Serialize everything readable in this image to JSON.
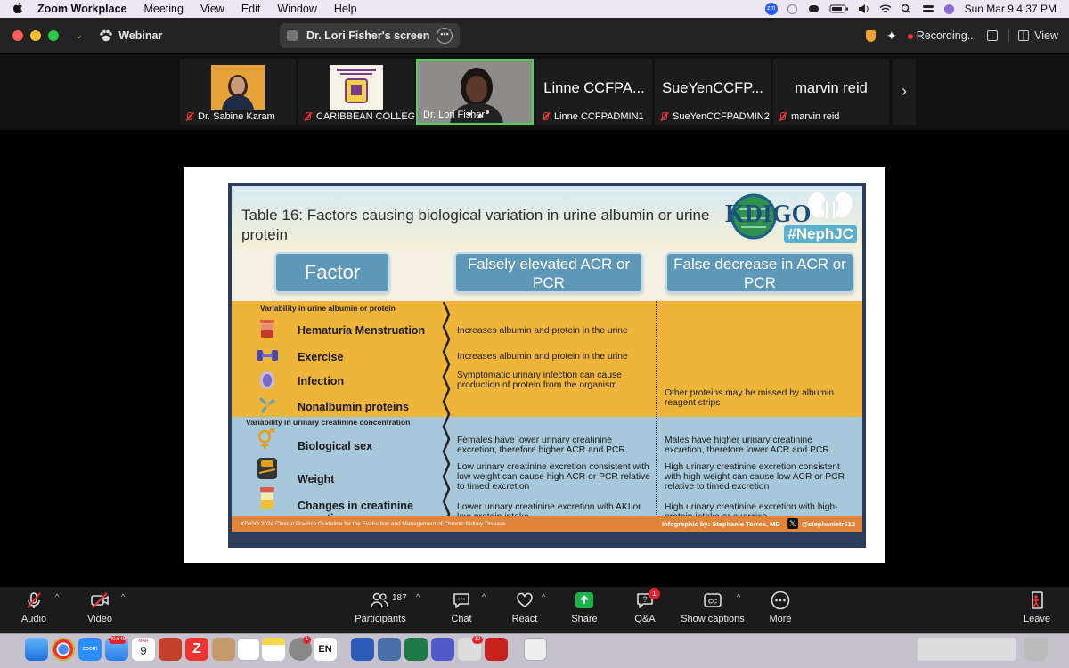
{
  "menubar": {
    "app": "Zoom Workplace",
    "items": [
      "Meeting",
      "View",
      "Edit",
      "Window",
      "Help"
    ],
    "datetime": "Sun Mar 9  4:37 PM"
  },
  "window": {
    "webinar_label": "Webinar",
    "share_title": "Dr. Lori Fisher's screen",
    "recording_label": "Recording...",
    "view_label": "View"
  },
  "participants_strip": [
    {
      "name": "Dr. Sabine Karam",
      "kind": "photo"
    },
    {
      "name": "CARIBBEAN COLLEG...",
      "kind": "logo"
    },
    {
      "name": "Dr. Lori Fisher",
      "kind": "video",
      "active": true
    },
    {
      "name": "Linne CCFPADMIN1",
      "display": "Linne CCFPA...",
      "kind": "text"
    },
    {
      "name": "SueYenCCFPADMIN2",
      "display": "SueYenCCFP...",
      "kind": "text"
    },
    {
      "name": "marvin reid",
      "display": "marvin reid",
      "kind": "text"
    }
  ],
  "slide": {
    "title": "Table 16: Factors causing biological variation in urine albumin or urine protein",
    "brand": "KDIGO",
    "hashtag": "#NephJC",
    "headers": {
      "factor": "Factor",
      "elevated": "Falsely elevated ACR or PCR",
      "decrease": "False decrease in ACR or PCR"
    },
    "section1": "Variability in urine albumin or protein",
    "section2": "Variability in urinary creatinine concentration",
    "rows": [
      {
        "factor": "Hematuria  Menstruation",
        "elevated": "Increases albumin and protein in the urine",
        "decrease": ""
      },
      {
        "factor": "Exercise",
        "elevated": "Increases albumin and protein in the urine",
        "decrease": ""
      },
      {
        "factor": "Infection",
        "elevated": "Symptomatic urinary infection can cause production of protein from the organism",
        "decrease": ""
      },
      {
        "factor": "Nonalbumin proteins",
        "elevated": "",
        "decrease": "Other proteins may be missed by albumin reagent strips"
      },
      {
        "factor": "Biological sex",
        "elevated": "Females have lower urinary creatinine excretion, therefore higher ACR and PCR",
        "decrease": "Males have higher urinary creatinine excretion, therefore lower ACR and PCR"
      },
      {
        "factor": "Weight",
        "elevated": "Low urinary creatinine excretion consistent with low weight can cause high ACR or PCR relative to timed excretion",
        "decrease": "High urinary creatinine excretion consistent with high weight can cause low ACR or PCR relative to timed excretion"
      },
      {
        "factor": "Changes in creatinine excretion",
        "elevated": "Lower urinary creatinine excretion with AKI or low-protein intake",
        "decrease": "High urinary creatinine excretion with high-protein intake or exercise"
      }
    ],
    "footer_source": "KDIGO 2024 Clinical Practice Guideline for the Evaluation and Management of Chronic Kidney Disease",
    "footer_credit": "Infographic by: Stephanie Torres, MD",
    "footer_handle": "@stephanietr612"
  },
  "controls": {
    "audio": "Audio",
    "video": "Video",
    "participants": "Participants",
    "participants_count": "187",
    "chat": "Chat",
    "react": "React",
    "share": "Share",
    "qa": "Q&A",
    "qa_badge": "1",
    "captions": "Show captions",
    "more": "More",
    "leave": "Leave"
  },
  "dock": {
    "mail_badge": "40,649",
    "calendar_month": "MAR",
    "calendar_day": "9",
    "settings_badge": "1",
    "lang": "EN",
    "teams_badge": "12"
  },
  "colors": {
    "accent_green": "#52d352",
    "share_green": "#19b34a",
    "infographic_yellow": "#efb53b",
    "infographic_blue": "#a7c7db",
    "header_blue": "#5e98b8"
  }
}
